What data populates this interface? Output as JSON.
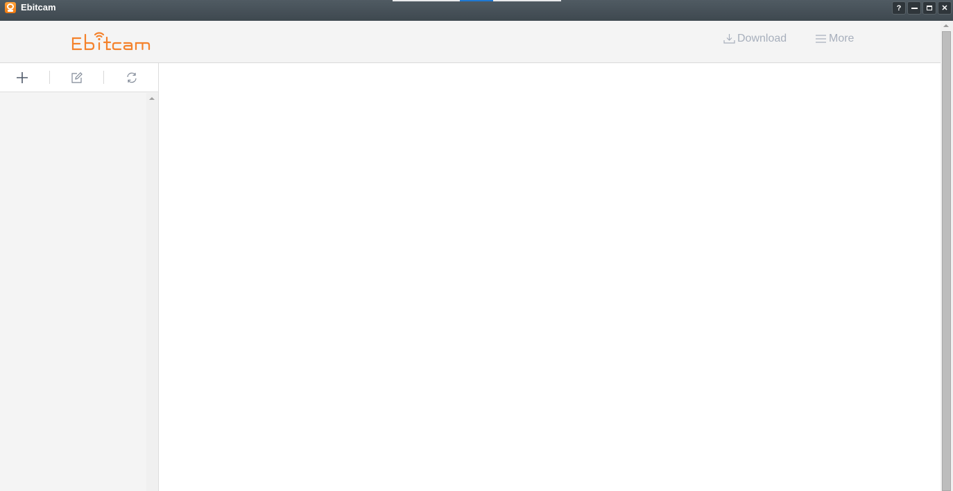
{
  "window": {
    "title": "Ebitcam",
    "buttons": {
      "help": "?",
      "close": "✕"
    }
  },
  "header": {
    "logo_text": "Ebitcam",
    "nav": {
      "download": "Download",
      "more": "More"
    }
  },
  "sidebar": {
    "toolbar": [
      {
        "name": "add",
        "icon": "plus-icon"
      },
      {
        "name": "edit",
        "icon": "edit-icon"
      },
      {
        "name": "refresh",
        "icon": "refresh-icon"
      }
    ],
    "items": []
  },
  "colors": {
    "brand": "#f4812a",
    "titlebar": "#46505a",
    "nav_text": "#a7afbc",
    "accent_indicator": "#1e78d2"
  }
}
